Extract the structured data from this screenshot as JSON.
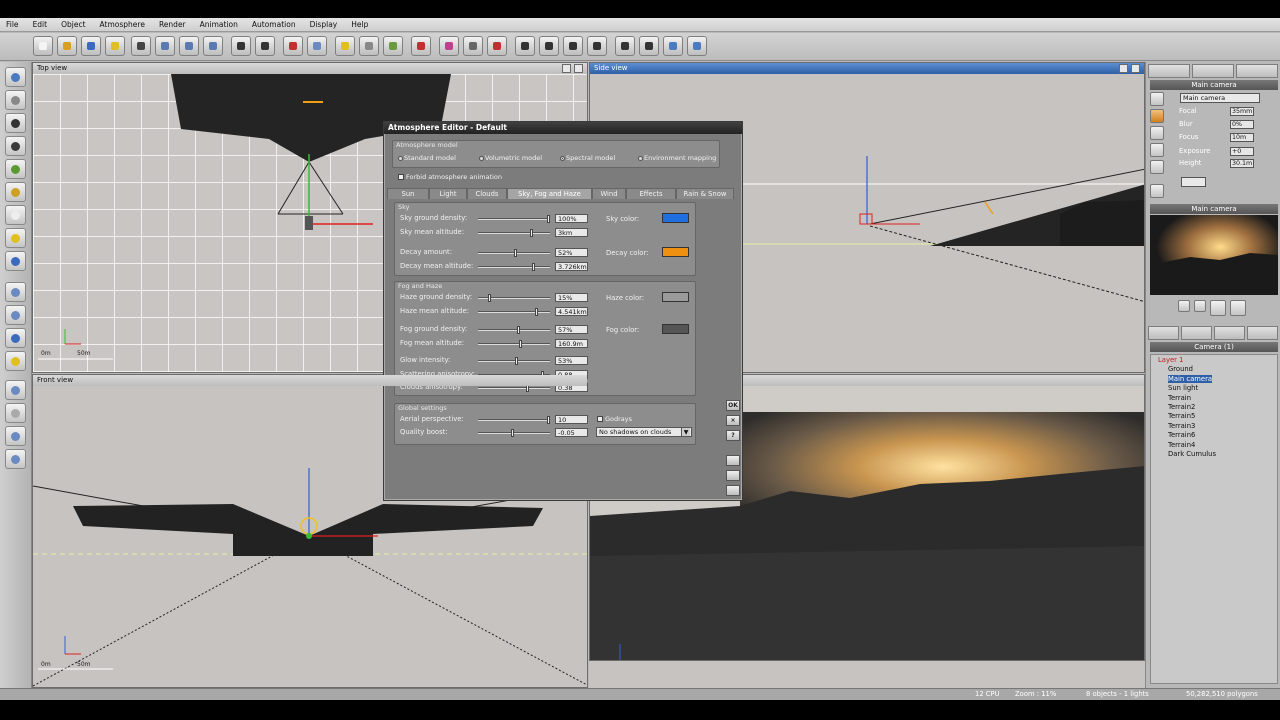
{
  "menu": [
    "File",
    "Edit",
    "Object",
    "Atmosphere",
    "Render",
    "Animation",
    "Automation",
    "Display",
    "Help"
  ],
  "viewports": {
    "top": "Top view",
    "side": "Side view",
    "front": "Front view",
    "scale_top": [
      "0m",
      "50m"
    ],
    "scale_front": [
      "0m",
      "50m"
    ]
  },
  "dialog": {
    "title": "Atmosphere Editor - Default",
    "model_label": "Atmosphere model",
    "models": [
      "Standard model",
      "Volumetric model",
      "Spectral model",
      "Environment mapping"
    ],
    "selected_model": "Spectral model",
    "forbid": "Forbid atmosphere animation",
    "tabs": [
      "Sun",
      "Light",
      "Clouds",
      "Sky, Fog and Haze",
      "Wind",
      "Effects",
      "Rain & Snow"
    ],
    "active_tab": "Sky, Fog and Haze",
    "sky": {
      "label": "Sky",
      "rows": [
        {
          "label": "Sky ground density:",
          "value": "100%",
          "pos": 1.0
        },
        {
          "label": "Sky mean altitude:",
          "value": "3km",
          "pos": 0.75
        },
        {
          "label": "Decay amount:",
          "value": "52%",
          "pos": 0.52
        },
        {
          "label": "Decay mean altitude:",
          "value": "3.726km",
          "pos": 0.78
        }
      ],
      "sky_color_label": "Sky color:",
      "sky_color": "#1f6fe0",
      "decay_color_label": "Decay color:",
      "decay_color": "#f09010"
    },
    "fog": {
      "label": "Fog and Haze",
      "rows": [
        {
          "label": "Haze ground density:",
          "value": "15%",
          "pos": 0.15
        },
        {
          "label": "Haze mean altitude:",
          "value": "4.541km",
          "pos": 0.82
        },
        {
          "label": "Fog ground density:",
          "value": "57%",
          "pos": 0.57
        },
        {
          "label": "Fog mean altitude:",
          "value": "160.9m",
          "pos": 0.6
        },
        {
          "label": "Glow intensity:",
          "value": "53%",
          "pos": 0.53
        },
        {
          "label": "Scattering anisotropy:",
          "value": "0.88",
          "pos": 0.92
        },
        {
          "label": "Clouds anisotropy:",
          "value": "0.38",
          "pos": 0.69
        }
      ],
      "haze_color_label": "Haze color:",
      "haze_color": "#9a9a9a",
      "fog_color_label": "Fog color:",
      "fog_color": "#555555"
    },
    "global": {
      "label": "Global settings",
      "rows": [
        {
          "label": "Aerial perspective:",
          "value": "10",
          "pos": 1.0
        },
        {
          "label": "Quality boost:",
          "value": "-0.05",
          "pos": 0.48
        }
      ],
      "godrays": "Godrays",
      "shadows": "No shadows on clouds"
    },
    "buttons": [
      "OK",
      "×",
      "?"
    ]
  },
  "right": {
    "camera_header": "Main camera",
    "camera_select": "Main camera",
    "props": [
      {
        "label": "Focal",
        "value": "35mm"
      },
      {
        "label": "Blur",
        "value": "0%"
      },
      {
        "label": "Focus",
        "value": "10m"
      },
      {
        "label": "Exposure",
        "value": "+0"
      },
      {
        "label": "Height",
        "value": "30.1m"
      }
    ],
    "preview_header": "Main camera",
    "tree_header": "Camera (1)",
    "tree": [
      "Layer 1",
      "Ground",
      "Main camera",
      "Sun light",
      "Terrain",
      "Terrain2",
      "Terrain5",
      "Terrain3",
      "Terrain6",
      "Terrain4",
      "Dark Cumulus"
    ],
    "selected": "Main camera"
  },
  "status": {
    "cpu": "12 CPU",
    "zoom": "Zoom : 11%",
    "objects": "8 objects - 1 lights",
    "polygons": "50,282,510 polygons"
  },
  "colors": {
    "accent": "#2f5fa6",
    "sun": "#f0a010"
  }
}
